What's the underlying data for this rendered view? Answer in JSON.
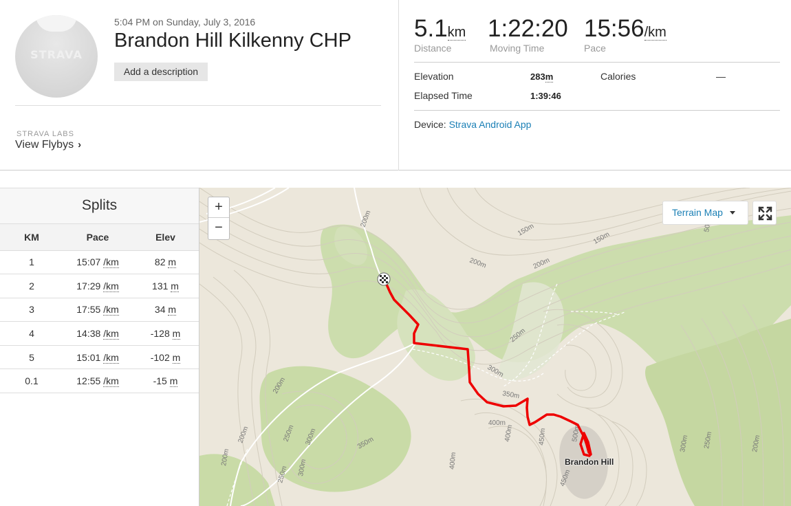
{
  "activity": {
    "datetime": "5:04 PM on Sunday, July 3, 2016",
    "title": "Brandon Hill Kilkenny CHP",
    "add_description_label": "Add a description",
    "avatar_brand": "STRAVA"
  },
  "labs": {
    "label": "STRAVA LABS",
    "flybys_label": "View Flybys"
  },
  "stats": {
    "distance": {
      "value": "5.1",
      "unit": "km",
      "label": "Distance"
    },
    "moving_time": {
      "value": "1:22:20",
      "label": "Moving Time"
    },
    "pace": {
      "value": "15:56",
      "unit": "/km",
      "label": "Pace"
    },
    "elevation": {
      "label": "Elevation",
      "value": "283",
      "unit": "m"
    },
    "calories": {
      "label": "Calories",
      "value": "—"
    },
    "elapsed_time": {
      "label": "Elapsed Time",
      "value": "1:39:46"
    },
    "device": {
      "label": "Device:",
      "value": "Strava Android App"
    }
  },
  "splits": {
    "title": "Splits",
    "columns": [
      "KM",
      "Pace",
      "Elev"
    ],
    "rows": [
      {
        "km": "1",
        "pace": "15:07",
        "elev": "82"
      },
      {
        "km": "2",
        "pace": "17:29",
        "elev": "131"
      },
      {
        "km": "3",
        "pace": "17:55",
        "elev": "34"
      },
      {
        "km": "4",
        "pace": "14:38",
        "elev": "-128"
      },
      {
        "km": "5",
        "pace": "15:01",
        "elev": "-102"
      },
      {
        "km": "0.1",
        "pace": "12:55",
        "elev": "-15"
      }
    ],
    "pace_unit": "/km",
    "elev_unit": "m"
  },
  "map": {
    "zoom_in": "+",
    "zoom_out": "−",
    "map_type_label": "Terrain Map",
    "peak_label": "Brandon Hill",
    "contour_labels": [
      "200m",
      "150m",
      "200m",
      "150m",
      "200m",
      "250m",
      "300m",
      "350m",
      "400m",
      "200m",
      "250m",
      "300m",
      "350m",
      "200m",
      "200m",
      "250m",
      "300m",
      "400m",
      "400m",
      "450m",
      "500m",
      "450m",
      "300m",
      "250m",
      "200m",
      "50m"
    ],
    "route_color": "#ee0000"
  }
}
